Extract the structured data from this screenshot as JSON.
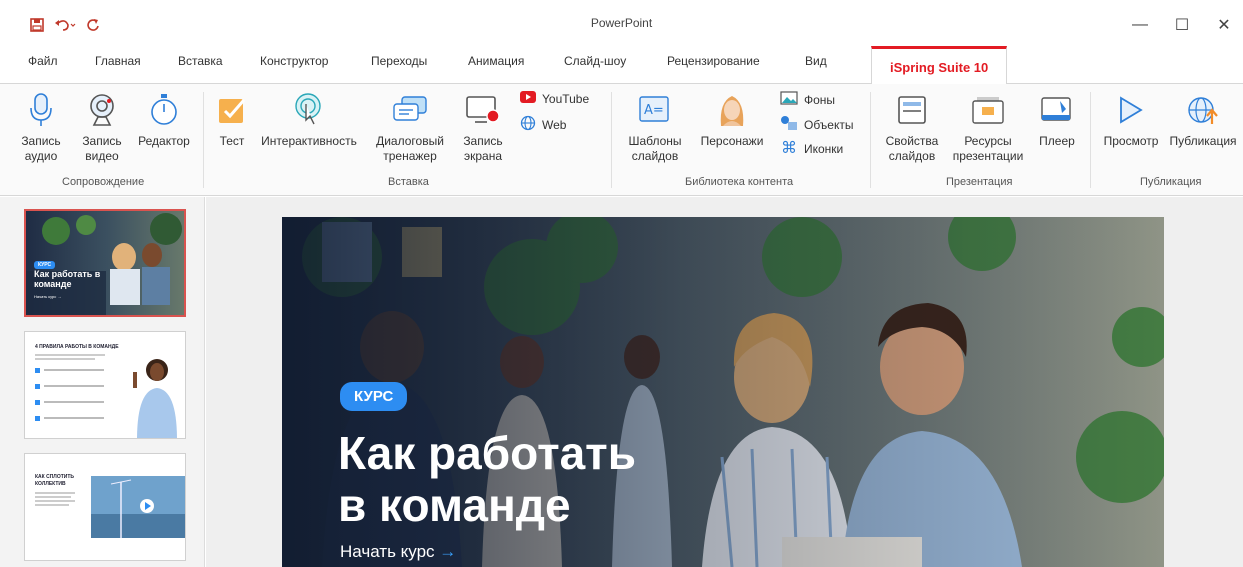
{
  "window": {
    "title": "PowerPoint",
    "min_glyph": "—",
    "max_glyph": "☐",
    "close_glyph": "✕"
  },
  "tabs": [
    "Файл",
    "Главная",
    "Вставка",
    "Конструктор",
    "Переходы",
    "Анимация",
    "Слайд-шоу",
    "Рецензирование",
    "Вид",
    "iSpring Suite 10"
  ],
  "ribbon": {
    "accompaniment": {
      "group_label": "Сопровождение",
      "record_audio": "Запись аудио",
      "record_video": "Запись видео",
      "editor": "Редактор"
    },
    "insert": {
      "group_label": "Вставка",
      "test": "Тест",
      "interactivity": "Интерактивность",
      "dialog_trainer": "Диалоговый тренажер",
      "screen_record": "Запись экрана",
      "youtube": "YouTube",
      "web": "Web"
    },
    "library": {
      "group_label": "Библиотека контента",
      "slide_templates": "Шаблоны слайдов",
      "characters": "Персонажи",
      "backgrounds": "Фоны",
      "objects": "Объекты",
      "icons": "Иконки"
    },
    "presentation": {
      "group_label": "Презентация",
      "slide_props": "Свойства слайдов",
      "resources": "Ресурсы презентации",
      "player": "Плеер"
    },
    "publish": {
      "group_label": "Публикация",
      "preview": "Просмотр",
      "publish": "Публикация"
    }
  },
  "thumbnails": [
    {
      "tag": "КУРС",
      "title": "Как работать в команде",
      "cta": "Начать курс →"
    },
    {
      "title": "4 ПРАВИЛА РАБОТЫ В КОМАНДЕ"
    },
    {
      "title": "КАК СПЛОТИТЬ КОЛЛЕКТИВ"
    }
  ],
  "slide": {
    "tag": "КУРС",
    "title_line1": "Как работать",
    "title_line2": "в команде",
    "cta_text": "Начать курс",
    "cta_arrow": "→"
  },
  "colors": {
    "accent_red": "#e31b23",
    "tag_blue": "#2d8df2",
    "icon_blue": "#2f7fd8"
  }
}
